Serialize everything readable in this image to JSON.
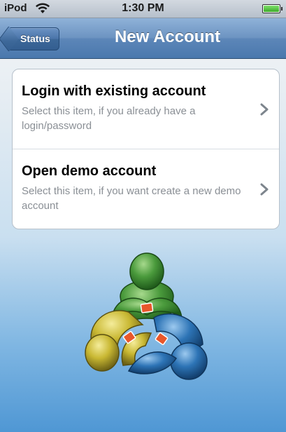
{
  "statusbar": {
    "carrier": "iPod",
    "time": "1:30 PM",
    "battery_level": 1.0
  },
  "navbar": {
    "back_label": "Status",
    "title": "New Account"
  },
  "menu": {
    "items": [
      {
        "title": "Login with existing account",
        "subtitle": "Select this item, if you already have a login/password"
      },
      {
        "title": "Open demo account",
        "subtitle": "Select this item, if you want create a new demo account"
      }
    ]
  },
  "icons": {
    "wifi": "wifi-icon",
    "battery": "battery-icon",
    "chevron": "chevron-right-icon",
    "logo": "metatrader-logo"
  },
  "colors": {
    "nav_bar": "#5c86b8",
    "logo_green": "#4a9a3c",
    "logo_yellow": "#c9b833",
    "logo_blue": "#2d74b6",
    "logo_accent": "#e8572b"
  }
}
